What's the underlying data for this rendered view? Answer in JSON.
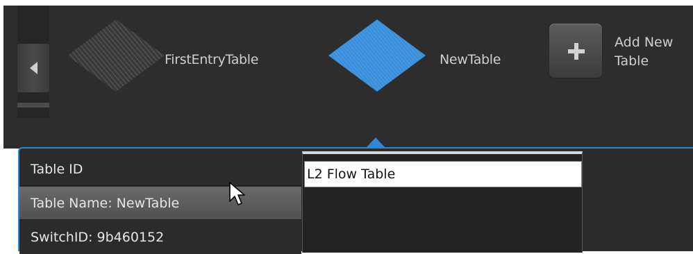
{
  "carousel": {
    "items": [
      {
        "label": "FirstEntryTable",
        "state": "inactive",
        "icon": "diamond-hatched-icon"
      },
      {
        "label": "NewTable",
        "state": "selected",
        "icon": "diamond-blue-icon"
      }
    ],
    "add_button": {
      "label": "Add New\nTable",
      "icon": "plus-icon"
    },
    "scroll_left_icon": "arrow-left-icon"
  },
  "detail": {
    "rows": [
      {
        "label": "Table ID"
      },
      {
        "label": "Table Name: NewTable",
        "highlighted": true
      },
      {
        "label": "SwitchID: 9b460152"
      }
    ],
    "editor": {
      "value": "L2 Flow Table",
      "placeholder": ""
    }
  },
  "colors": {
    "background": "#2d2d2d",
    "accent": "#2d86d6",
    "selected_diamond": "#3b8fd8",
    "inactive_diamond": "#4a4a4a",
    "text": "#cfcfcf"
  }
}
